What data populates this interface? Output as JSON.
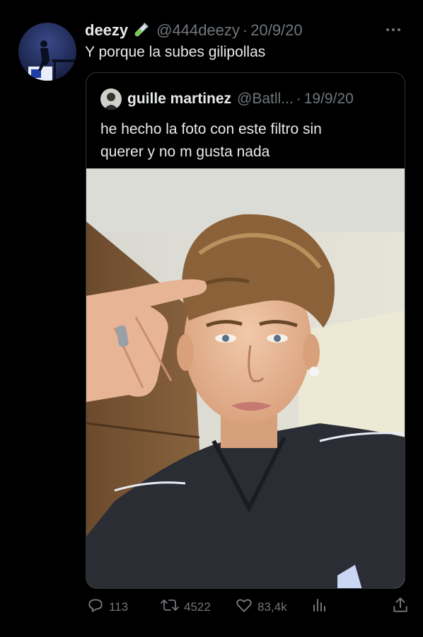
{
  "tweet": {
    "author_name": "deezy",
    "author_emoji": "test-tube-icon",
    "handle": "@444deezy",
    "separator": "·",
    "date": "20/9/20",
    "text": "Y porque la subes gilipollas",
    "more_icon": "more-icon"
  },
  "quote": {
    "author_name": "guille martinez",
    "handle": "@Batll...",
    "separator": "·",
    "date": "19/9/20",
    "text_lines": [
      "he hecho la foto con este filtro sin",
      "querer y no m gusta nada"
    ]
  },
  "actions": {
    "replies": "113",
    "retweets": "4522",
    "likes": "83,4k",
    "views_icon": "views-icon",
    "share_icon": "share-icon"
  },
  "colors": {
    "background": "#000000",
    "text": "#e7e9ea",
    "muted": "#71767b",
    "border": "#2f3336"
  }
}
